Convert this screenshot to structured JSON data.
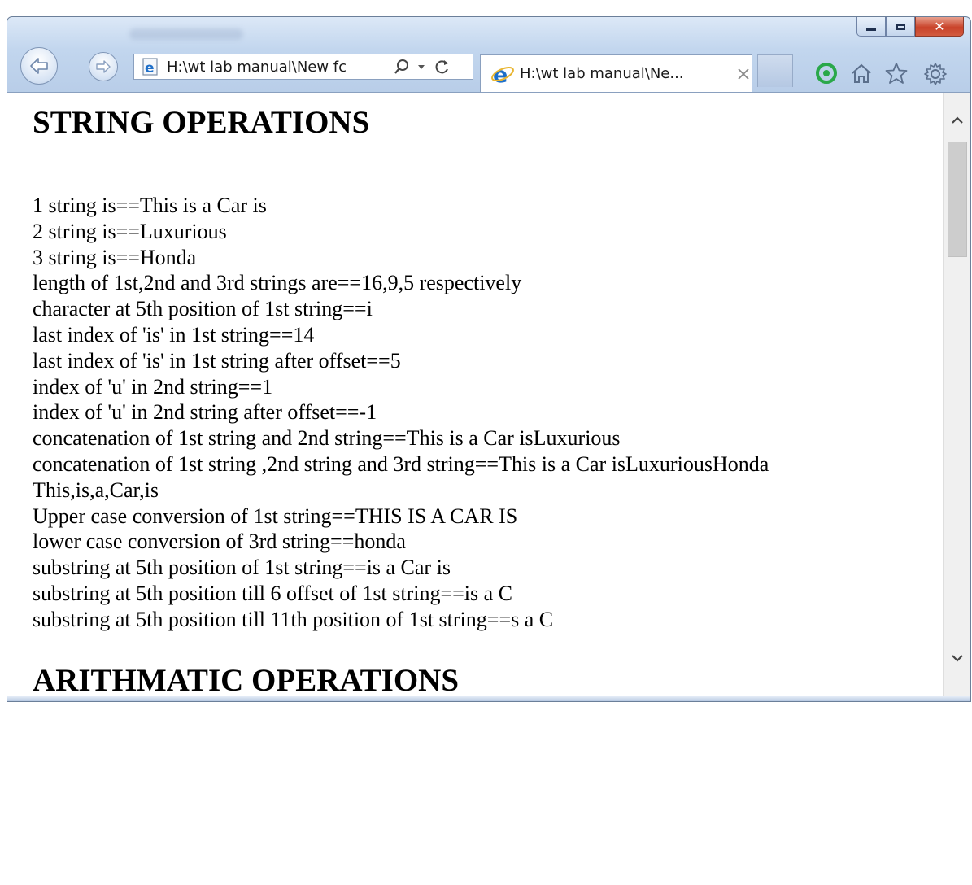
{
  "browser": {
    "address_text": "H:\\wt lab manual\\New fc",
    "tab_title": "H:\\wt lab manual\\Ne..."
  },
  "page": {
    "heading1": "STRING OPERATIONS",
    "lines": [
      "1 string is==This is a Car is",
      "2 string is==Luxurious",
      "3 string is==Honda",
      "length of 1st,2nd and 3rd strings are==16,9,5 respectively",
      "character at 5th position of 1st string==i",
      "last index of 'is' in 1st string==14",
      "last index of 'is' in 1st string after offset==5",
      "index of 'u' in 2nd string==1",
      "index of 'u' in 2nd string after offset==-1",
      "concatenation of 1st string and 2nd string==This is a Car isLuxurious",
      "concatenation of 1st string ,2nd string and 3rd string==This is a Car isLuxuriousHonda",
      "This,is,a,Car,is",
      "Upper case conversion of 1st string==THIS IS A CAR IS",
      "lower case conversion of 3rd string==honda",
      "substring at 5th position of 1st string==is a Car is",
      "substring at 5th position till 6 offset of 1st string==is a C",
      "substring at 5th position till 11th position of 1st string==s a C"
    ],
    "heading2": "ARITHMATIC OPERATIONS"
  },
  "icons": {
    "back": "back-arrow-icon",
    "forward": "forward-arrow-icon",
    "ie_page": "ie-page-icon",
    "search": "search-icon",
    "dropdown": "dropdown-icon",
    "refresh": "refresh-icon",
    "tab_close": "close-icon",
    "feedback": "green-circle-icon",
    "home": "home-icon",
    "favorites": "star-icon",
    "tools": "gear-icon"
  },
  "colors": {
    "window_frame": "#c2d6ee",
    "close_button": "#c9432a",
    "ie_logo": "#1e6fc9",
    "feedback_green": "#2aa84a"
  }
}
